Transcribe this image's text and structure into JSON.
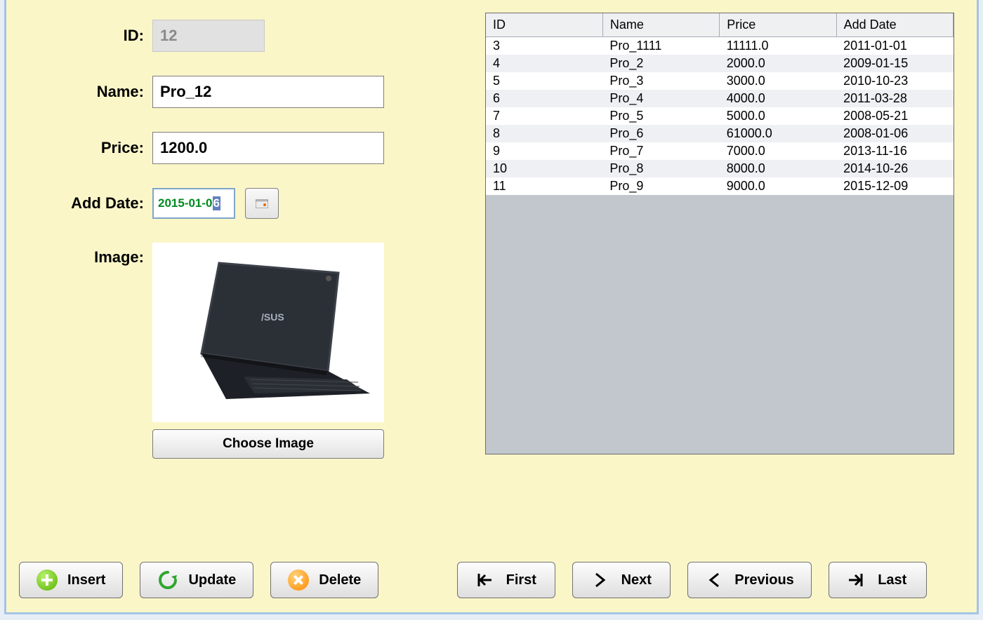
{
  "form": {
    "labels": {
      "id": "ID:",
      "name": "Name:",
      "price": "Price:",
      "add_date": "Add Date:",
      "image": "Image:"
    },
    "values": {
      "id": "12",
      "name": "Pro_12",
      "price": "1200.0",
      "add_date_prefix": "2015-01-0",
      "add_date_selected_char": "6"
    },
    "choose_image_label": "Choose Image"
  },
  "table": {
    "columns": [
      "ID",
      "Name",
      "Price",
      "Add Date"
    ],
    "rows": [
      [
        "3",
        "Pro_1111",
        "11111.0",
        "2011-01-01"
      ],
      [
        "4",
        "Pro_2",
        "2000.0",
        "2009-01-15"
      ],
      [
        "5",
        "Pro_3",
        "3000.0",
        "2010-10-23"
      ],
      [
        "6",
        "Pro_4",
        "4000.0",
        "2011-03-28"
      ],
      [
        "7",
        "Pro_5",
        "5000.0",
        "2008-05-21"
      ],
      [
        "8",
        "Pro_6",
        "61000.0",
        "2008-01-06"
      ],
      [
        "9",
        "Pro_7",
        "7000.0",
        "2013-11-16"
      ],
      [
        "10",
        "Pro_8",
        "8000.0",
        "2014-10-26"
      ],
      [
        "11",
        "Pro_9",
        "9000.0",
        "2015-12-09"
      ]
    ]
  },
  "buttons": {
    "insert": "Insert",
    "update": "Update",
    "delete": "Delete",
    "first": "First",
    "next": "Next",
    "previous": "Previous",
    "last": "Last"
  },
  "colors": {
    "panel_bg": "#fbf6c8",
    "window_border": "#a3c4e6",
    "date_text": "#008a1f"
  }
}
